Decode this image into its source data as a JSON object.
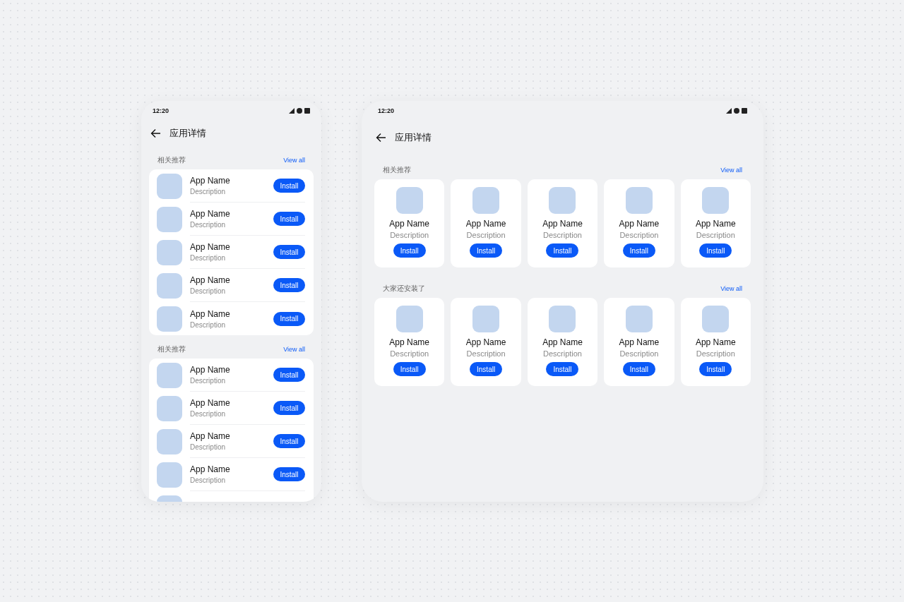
{
  "phone": {
    "status_time": "12:20",
    "title": "应用详情",
    "sections": [
      {
        "title": "相关推荐",
        "link": "View all",
        "apps": [
          {
            "kind": "full",
            "name": "App Name",
            "description": "Description",
            "button": "Install"
          },
          {
            "kind": "full",
            "name": "App Name",
            "description": "Description",
            "button": "Install"
          },
          {
            "kind": "full",
            "name": "App Name",
            "description": "Description",
            "button": "Install"
          },
          {
            "kind": "full",
            "name": "App Name",
            "description": "Description",
            "button": "Install"
          },
          {
            "kind": "full",
            "name": "App Name",
            "description": "Description",
            "button": "Install"
          }
        ]
      },
      {
        "title": "相关推荐",
        "link": "View all",
        "apps": [
          {
            "kind": "full",
            "name": "App Name",
            "description": "Description",
            "button": "Install"
          },
          {
            "kind": "full",
            "name": "App Name",
            "description": "Description",
            "button": "Install"
          },
          {
            "kind": "full",
            "name": "App Name",
            "description": "Description",
            "button": "Install"
          },
          {
            "kind": "full",
            "name": "App Name",
            "description": "Description",
            "button": "Install"
          },
          {
            "kind": "clipped"
          }
        ]
      }
    ]
  },
  "tablet": {
    "status_time": "12:20",
    "title": "应用详情",
    "sections": [
      {
        "title": "相关推荐",
        "link": "View all",
        "apps": [
          {
            "name": "App Name",
            "description": "Description",
            "button": "Install"
          },
          {
            "name": "App Name",
            "description": "Description",
            "button": "Install"
          },
          {
            "name": "App Name",
            "description": "Description",
            "button": "Install"
          },
          {
            "name": "App Name",
            "description": "Description",
            "button": "Install"
          },
          {
            "name": "App Name",
            "description": "Description",
            "button": "Install"
          }
        ]
      },
      {
        "title": "大家还安装了",
        "link": "View all",
        "apps": [
          {
            "name": "App Name",
            "description": "Description",
            "button": "Install"
          },
          {
            "name": "App Name",
            "description": "Description",
            "button": "Install"
          },
          {
            "name": "App Name",
            "description": "Description",
            "button": "Install"
          },
          {
            "name": "App Name",
            "description": "Description",
            "button": "Install"
          },
          {
            "name": "App Name",
            "description": "Description",
            "button": "Install"
          }
        ]
      }
    ]
  }
}
